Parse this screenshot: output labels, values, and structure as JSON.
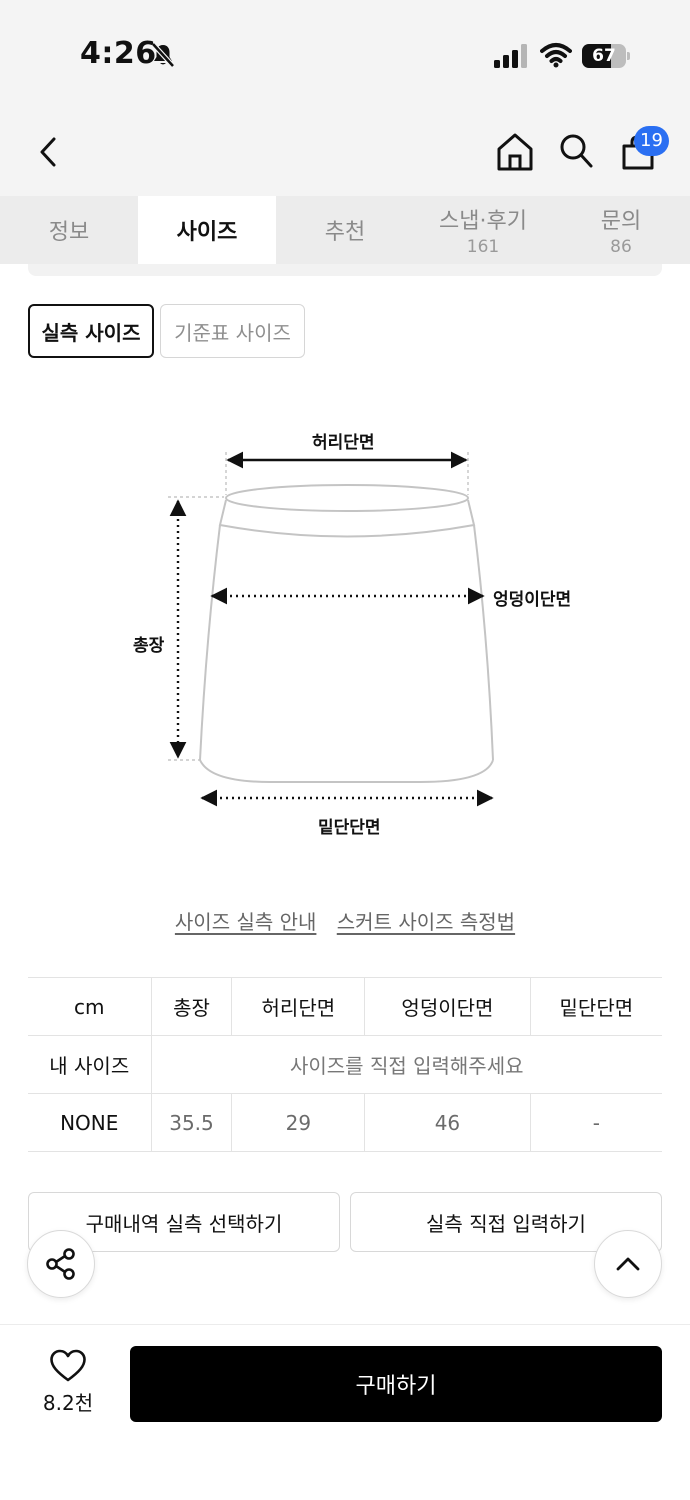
{
  "status_bar": {
    "time": "4:26",
    "battery": "67",
    "battery_level": 0.67
  },
  "nav": {
    "cart_count": "19"
  },
  "tabs": [
    {
      "label": "정보",
      "count": ""
    },
    {
      "label": "사이즈",
      "count": ""
    },
    {
      "label": "추천",
      "count": ""
    },
    {
      "label": "스냅·후기",
      "count": "161"
    },
    {
      "label": "문의",
      "count": "86"
    }
  ],
  "toggle": {
    "actual": "실측 사이즈",
    "standard": "기준표 사이즈"
  },
  "diagram": {
    "waist": "허리단면",
    "hip": "엉덩이단면",
    "length": "총장",
    "hem": "밑단단면"
  },
  "links": {
    "guide": "사이즈 실측 안내",
    "method": "스커트 사이즈 측정법"
  },
  "table": {
    "unit": "cm",
    "headers": [
      "총장",
      "허리단면",
      "엉덩이단면",
      "밑단단면"
    ],
    "my_size_label": "내 사이즈",
    "my_size_hint": "사이즈를 직접 입력해주세요",
    "row_label": "NONE",
    "row_values": [
      "35.5",
      "29",
      "46",
      "-"
    ]
  },
  "actions": {
    "history": "구매내역 실측 선택하기",
    "direct": "실측 직접 입력하기"
  },
  "bottom": {
    "likes": "8.2천",
    "buy": "구매하기"
  },
  "colors": {
    "badge": "#2a6ff2",
    "buy_bg": "#000000",
    "chrome_bg": "#f4f4f4"
  }
}
